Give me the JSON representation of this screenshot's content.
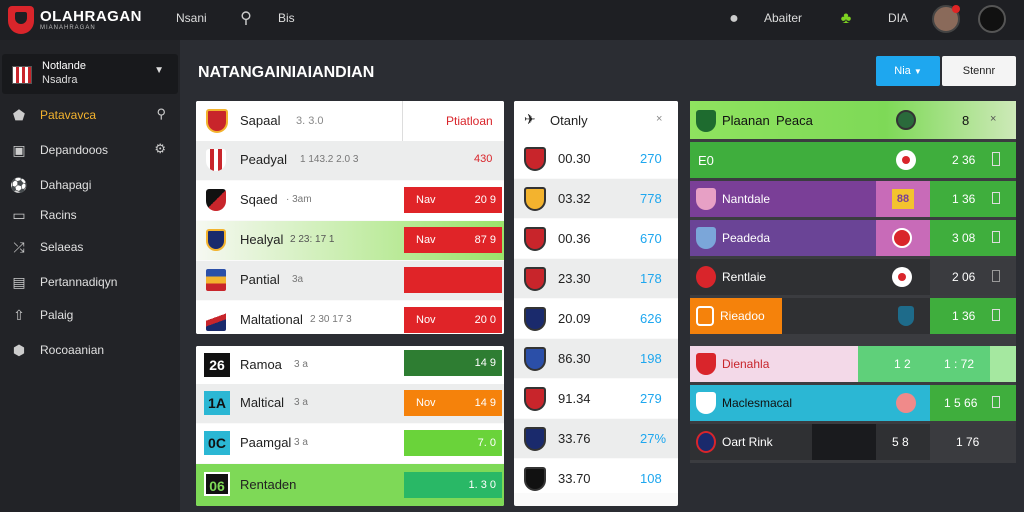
{
  "topbar": {
    "logo_title": "OLAHRAGAN",
    "logo_sub": "MIANAHRAGAN",
    "link1": "Nsani",
    "link2": "Bis",
    "user_label": "Abaiter",
    "short": "DIA"
  },
  "sidebar": {
    "team_line1": "Notlande",
    "team_line2": "Nsadra",
    "items": [
      {
        "label": "Patavavca",
        "icon": "shield-icon"
      },
      {
        "label": "Depandooos",
        "icon": "calendar-icon"
      },
      {
        "label": "Dahapagi",
        "icon": "ball-icon"
      },
      {
        "label": "Racins",
        "icon": "monitor-icon"
      },
      {
        "label": "Selaeas",
        "icon": "swap-icon"
      },
      {
        "label": "Pertannadiqyn",
        "icon": "board-icon"
      },
      {
        "label": "Palaig",
        "icon": "upload-icon"
      },
      {
        "label": "Rocoaanian",
        "icon": "badge-icon"
      }
    ]
  },
  "main": {
    "title": "NATANGAINIAIANDIAN",
    "btn_blue": "Nia",
    "btn_white": "Stennr"
  },
  "card1": {
    "header_name": "Sapaal",
    "header_score": "3. 3.0",
    "header_right": "Ptiatloan",
    "rows": [
      {
        "name": "Peadyal",
        "meta": "1 143.2 2.0 3",
        "badge": "",
        "value": "430"
      },
      {
        "name": "Sqaed",
        "meta": "· 3am",
        "badge": "Nav",
        "value": "20 9"
      },
      {
        "name": "Healyal",
        "meta": "2 23: 17 1",
        "badge": "Nav",
        "value": "87 9"
      },
      {
        "name": "Pantial",
        "meta": "3a",
        "badge": "",
        "value": ""
      },
      {
        "name": "Maltational",
        "meta": "2 30 17 3",
        "badge": "Nov",
        "value": "20 0"
      }
    ]
  },
  "card2": {
    "rows": [
      {
        "tag": "26",
        "name": "Ramoa",
        "meta": "3 a",
        "badge": "",
        "value": "14 9"
      },
      {
        "tag": "1A",
        "name": "Maltical",
        "meta": "3 a",
        "badge": "Nov",
        "value": "14 9"
      },
      {
        "tag": "0C",
        "name": "Paamgal",
        "meta": "3 a",
        "badge": "",
        "value": "7. 0"
      },
      {
        "tag": "06",
        "name": "Rentaden",
        "meta": "",
        "badge": "",
        "value": "1. 3 0"
      }
    ]
  },
  "card3": {
    "header": "Otanly",
    "rows": [
      {
        "left": "00.30",
        "right": "270"
      },
      {
        "left": "03.32",
        "right": "778"
      },
      {
        "left": "00.36",
        "right": "670"
      },
      {
        "left": "23.30",
        "right": "178"
      },
      {
        "left": "20.09",
        "right": "626"
      },
      {
        "left": "86.30",
        "right": "198"
      },
      {
        "left": "91.34",
        "right": "279"
      },
      {
        "left": "33.76",
        "right": "27%"
      },
      {
        "left": "33.70",
        "right": "108"
      }
    ]
  },
  "card4": {
    "header_name": "Plaanan",
    "header_name2": "Peaca",
    "header_value": "8",
    "rows": [
      {
        "name": "E0",
        "value": "2 36"
      },
      {
        "name": "Nantdale",
        "badge": "88",
        "value": "1 36"
      },
      {
        "name": "Peadeda",
        "value": "3 08"
      },
      {
        "name": "Rentlaie",
        "value": "2 06"
      },
      {
        "name": "Rieadoo",
        "value": "1 36"
      }
    ]
  },
  "card5": {
    "rows": [
      {
        "name": "Dienahla",
        "v1": "1 2",
        "v2": "1 : 72"
      },
      {
        "name": "Maclesmacal",
        "v1": "",
        "v2": "1 5 66"
      },
      {
        "name": "Oart Rink",
        "v1": "5 8",
        "v2": "1 76"
      }
    ]
  }
}
